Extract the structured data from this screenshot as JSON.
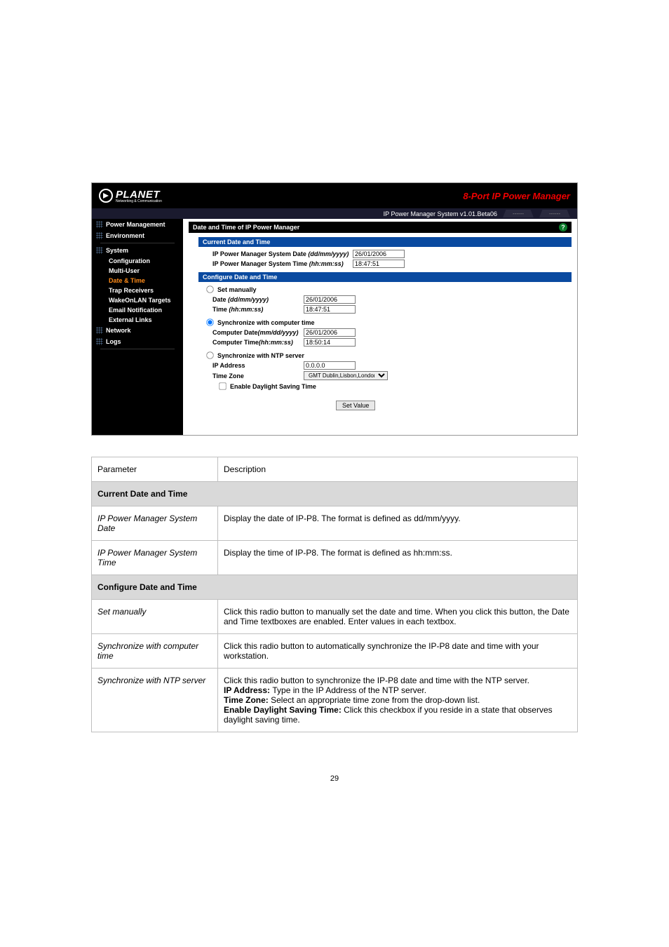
{
  "header": {
    "brand": "PLANET",
    "brand_sub": "Networking & Communication",
    "product": "8-Port IP Power Manager",
    "system_line": "IP Power Manager System v1.01.Beta06",
    "tab1": "------",
    "tab2": "------"
  },
  "sidebar": {
    "power_management": "Power Management",
    "environment": "Environment",
    "system": "System",
    "items": {
      "configuration": "Configuration",
      "multi_user": "Multi-User",
      "date_time": "Date & Time",
      "trap_receivers": "Trap Receivers",
      "wol": "WakeOnLAN Targets",
      "email": "Email Notification",
      "ext_links": "External Links"
    },
    "network": "Network",
    "logs": "Logs"
  },
  "panel": {
    "title": "Date and Time of IP Power Manager",
    "section_current": "Current Date and Time",
    "sys_date_lbl": "IP Power Manager System Date ",
    "sys_date_fmt": "(dd/mm/yyyy)",
    "sys_date_val": "26/01/2006",
    "sys_time_lbl": "IP Power Manager System Time ",
    "sys_time_fmt": "(hh:mm:ss)",
    "sys_time_val": "18:47:51",
    "section_configure": "Configure Date and Time",
    "radio_manual": "Set manually",
    "manual_date_lbl": "Date ",
    "manual_date_fmt": "(dd/mm/yyyy)",
    "manual_date_val": "26/01/2006",
    "manual_time_lbl": "Time ",
    "manual_time_fmt": "(hh:mm:ss)",
    "manual_time_val": "18:47:51",
    "radio_sync_pc": "Synchronize with computer time",
    "comp_date_lbl": "Computer Date",
    "comp_date_fmt": "(mm/dd/yyyy)",
    "comp_date_val": "26/01/2006",
    "comp_time_lbl": "Computer Time",
    "comp_time_fmt": "(hh:mm:ss)",
    "comp_time_val": "18:50:14",
    "radio_ntp": "Synchronize with NTP server",
    "ip_lbl": "IP Address",
    "ip_val": "0.0.0.0",
    "tz_lbl": "Time Zone",
    "tz_val": "GMT Dublin,Lisbon,London",
    "dst_lbl": "Enable Daylight Saving Time",
    "set_btn": "Set Value"
  },
  "table": {
    "h_param": "Parameter",
    "h_desc": "Description",
    "grp_current": "Current Date and Time",
    "r1_p": "IP Power Manager System Date",
    "r1_d": "Display the date of IP-P8. The format is defined as dd/mm/yyyy.",
    "r2_p": "IP Power Manager System Time",
    "r2_d": "Display the time of IP-P8. The format is defined as hh:mm:ss.",
    "grp_configure": "Configure Date and Time",
    "r3_p": "Set manually",
    "r3_d": "Click this radio button to manually set the date and time. When you click this button, the Date and Time textboxes are enabled. Enter values in each textbox.",
    "r4_p": "Synchronize with computer time",
    "r4_d": "Click this radio button to automatically synchronize the IP-P8 date and time with your workstation.",
    "r5_p": "Synchronize with NTP server",
    "r5_d_1": "Click this radio button to synchronize the IP-P8 date and time with the NTP server.",
    "r5_d_2_b": "IP Address: ",
    "r5_d_2": "Type in the IP Address of the NTP server.",
    "r5_d_3_b": "Time Zone: ",
    "r5_d_3": "Select an appropriate time zone from the drop-down list.",
    "r5_d_4_b": "Enable Daylight Saving Time: ",
    "r5_d_4": "Click this checkbox if you reside in a state that observes daylight saving time."
  },
  "page_number": "29"
}
